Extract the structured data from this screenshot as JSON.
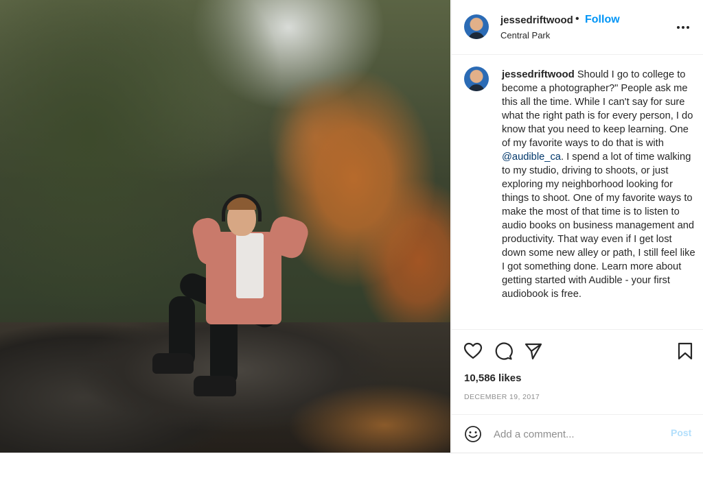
{
  "post": {
    "username": "jessedriftwood",
    "separator": "•",
    "follow_label": "Follow",
    "location": "Central Park",
    "more_icon": "more-options-icon",
    "image_alt": "Man with headphones sitting on a rock in a park"
  },
  "caption": {
    "username": "jessedriftwood",
    "text_before_mention": "Should I go to college to become a photographer?\" People ask me this all the time. While I can't say for sure what the right path is for every person, I do know that you need to keep learning. One of my favorite ways to do that is with",
    "mention": "@audible_ca",
    "text_after_mention": ". I spend a lot of time walking to my studio, driving to shoots, or just exploring my neighborhood looking for things to shoot. One of my favorite ways to make the most of that time is to listen to audio books on business management and productivity. That way even if I get lost down some new alley or path, I still feel like I got something done. Learn more about getting started with Audible - your first audiobook is free."
  },
  "actions": {
    "icons": [
      "heart-icon",
      "comment-icon",
      "share-icon",
      "bookmark-icon"
    ]
  },
  "stats": {
    "likes": "10,586 likes",
    "date": "DECEMBER 19, 2017"
  },
  "comment": {
    "placeholder": "Add a comment...",
    "post_label": "Post"
  },
  "colors": {
    "accent": "#0095f6",
    "post_disabled": "#b2dffc",
    "mention": "#00376b",
    "muted": "#8e8e8e"
  }
}
